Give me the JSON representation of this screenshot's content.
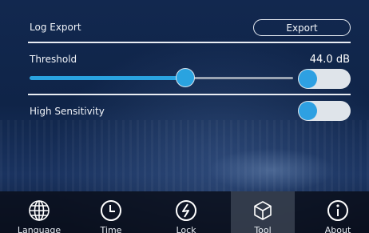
{
  "log_export": {
    "label": "Log Export",
    "button_label": "Export"
  },
  "threshold": {
    "label": "Threshold",
    "value_text": "44.0 dB",
    "slider_fraction": 0.59,
    "toggle_on": false
  },
  "high_sensitivity": {
    "label": "High Sensitivity",
    "toggle_on": false
  },
  "nav": {
    "items": [
      {
        "label": "Language",
        "icon": "globe-icon"
      },
      {
        "label": "Time",
        "icon": "clock-icon"
      },
      {
        "label": "Lock",
        "icon": "lightning-icon"
      },
      {
        "label": "Tool",
        "icon": "cube-icon",
        "selected": true
      },
      {
        "label": "About",
        "icon": "info-icon"
      }
    ]
  },
  "colors": {
    "accent": "#2aa3e0",
    "toggle_track": "#dfe4ea",
    "bar_bg": "#0a0e18"
  }
}
